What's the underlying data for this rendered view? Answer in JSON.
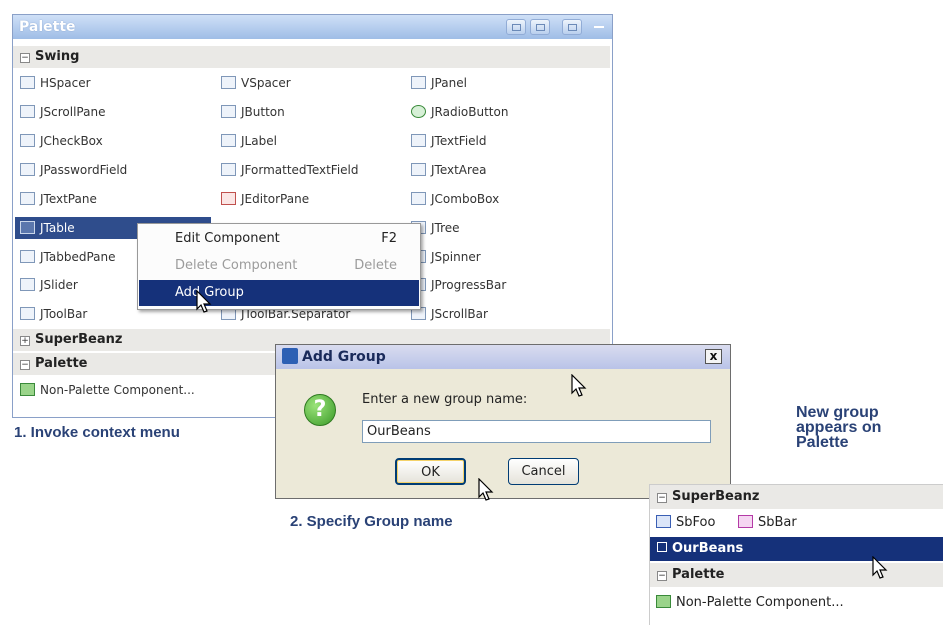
{
  "palette": {
    "title": "Palette",
    "categories": {
      "swing": "Swing",
      "superbeanz": "SuperBeanz",
      "palette": "Palette"
    },
    "items": {
      "hspacer": "HSpacer",
      "vspacer": "VSpacer",
      "jpanel": "JPanel",
      "jscrollpane": "JScrollPane",
      "jbutton": "JButton",
      "jradiobutton": "JRadioButton",
      "jcheckbox": "JCheckBox",
      "jlabel": "JLabel",
      "jtextfield": "JTextField",
      "jpasswordfield": "JPasswordField",
      "jformattedtextfield": "JFormattedTextField",
      "jtextarea": "JTextArea",
      "jtextpane": "JTextPane",
      "jeditorpane": "JEditorPane",
      "jcombobox": "JComboBox",
      "jtable": "JTable",
      "jtree": "JTree",
      "jtabbedpane": "JTabbedPane",
      "jspinner": "JSpinner",
      "jslider": "JSlider",
      "jprogressbar": "JProgressBar",
      "jtoolbar": "JToolBar",
      "jtoolbar_separator": "JToolBar.Separator",
      "jscrollbar": "JScrollBar",
      "nonpalette": "Non-Palette Component..."
    }
  },
  "context_menu": {
    "edit": {
      "label": "Edit Component",
      "key": "F2"
    },
    "delete": {
      "label": "Delete Component",
      "key": "Delete"
    },
    "add_group": {
      "label": "Add Group"
    }
  },
  "captions": {
    "step1": "1. Invoke context menu",
    "step2": "2. Specify Group name",
    "note": [
      "New group",
      "appears on",
      "Palette"
    ]
  },
  "dialog": {
    "title": "Add Group",
    "close": "x",
    "icon": "?",
    "prompt": "Enter a new group name:",
    "value": "OurBeans",
    "ok": "OK",
    "cancel": "Cancel"
  },
  "snippet": {
    "superbeanz": "SuperBeanz",
    "sbfoo": "SbFoo",
    "sbbar": "SbBar",
    "ourbeans": "OurBeans",
    "palette": "Palette",
    "nonpalette": "Non-Palette Component..."
  },
  "icons": [
    "spacer-icon",
    "component-icon",
    "question-icon",
    "close-icon",
    "bean-icon",
    "mouse-cursor-icon"
  ]
}
